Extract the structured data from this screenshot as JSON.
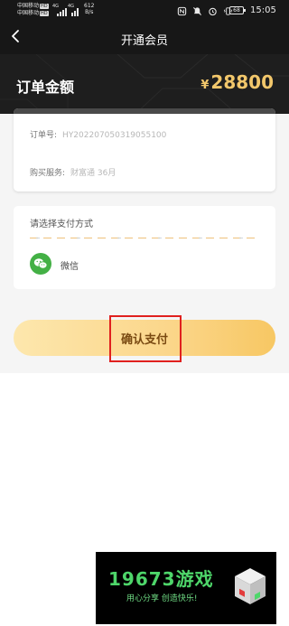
{
  "status_bar": {
    "carrier_1": "中国移动",
    "carrier_2": "中国移动",
    "hd_badge": "HD",
    "signal_1": "4G",
    "signal_2": "4G",
    "net_speed_value": "612",
    "net_speed_unit": "B/s",
    "battery": "68",
    "time": "15:05"
  },
  "nav": {
    "back_icon": "chevron-left-icon",
    "title": "开通会员"
  },
  "amount": {
    "label": "订单金额",
    "currency_symbol": "¥",
    "value": "28800"
  },
  "order": {
    "order_no_label": "订单号:",
    "order_no_value": "HY202207050319055100",
    "service_label": "购买服务:",
    "service_value": "财富通 36月"
  },
  "payment": {
    "section_title": "请选择支付方式",
    "method_icon": "wechat-icon",
    "method_label": "微信"
  },
  "confirm_button": {
    "label": "确认支付"
  },
  "watermark": {
    "text": "19673游戏",
    "tagline": "用心分享  创造快乐!"
  },
  "colors": {
    "header_bg": "#171717",
    "amount_gold": "#f2c76b",
    "button_gradient_start": "#fde7ad",
    "button_gradient_end": "#f7c763",
    "wechat_green": "#43b045",
    "highlight_red": "#e0201e"
  }
}
